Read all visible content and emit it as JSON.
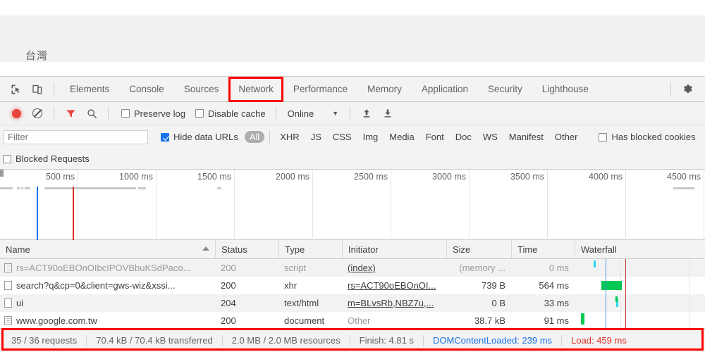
{
  "page": {
    "site_text": "台灣"
  },
  "devtools": {
    "toolbar_icons": {
      "inspect": "inspect-element-icon",
      "device": "device-toolbar-icon",
      "settings": "gear-icon"
    },
    "tabs": [
      {
        "label": "Elements",
        "active": false
      },
      {
        "label": "Console",
        "active": false
      },
      {
        "label": "Sources",
        "active": false
      },
      {
        "label": "Network",
        "active": true
      },
      {
        "label": "Performance",
        "active": false
      },
      {
        "label": "Memory",
        "active": false
      },
      {
        "label": "Application",
        "active": false
      },
      {
        "label": "Security",
        "active": false
      },
      {
        "label": "Lighthouse",
        "active": false
      }
    ]
  },
  "network_toolbar": {
    "record_label": "record-button",
    "clear_label": "clear-button",
    "filter_icon": "filter-funnel-icon",
    "search_icon": "search-icon",
    "preserve_log": {
      "label": "Preserve log",
      "checked": false
    },
    "disable_cache": {
      "label": "Disable cache",
      "checked": false
    },
    "throttling": {
      "value": "Online"
    },
    "import_icon": "upload-har-icon",
    "export_icon": "download-har-icon"
  },
  "filter_bar": {
    "filter_placeholder": "Filter",
    "filter_value": "",
    "hide_data_urls": {
      "label": "Hide data URLs",
      "checked": true
    },
    "types": [
      "All",
      "XHR",
      "JS",
      "CSS",
      "Img",
      "Media",
      "Font",
      "Doc",
      "WS",
      "Manifest",
      "Other"
    ],
    "selected_type": "All",
    "has_blocked_cookies": {
      "label": "Has blocked cookies",
      "checked": false
    },
    "blocked_requests": {
      "label": "Blocked Requests",
      "checked": false
    }
  },
  "overview": {
    "ticks": [
      "500 ms",
      "1000 ms",
      "1500 ms",
      "2000 ms",
      "2500 ms",
      "3000 ms",
      "3500 ms",
      "4000 ms",
      "4500 ms"
    ],
    "dom_content_loaded_color": "#1a73e8",
    "load_color": "#d93025"
  },
  "table": {
    "columns": [
      {
        "label": "Name",
        "sorted": true
      },
      {
        "label": "Status",
        "sorted": false
      },
      {
        "label": "Type",
        "sorted": false
      },
      {
        "label": "Initiator",
        "sorted": false
      },
      {
        "label": "Size",
        "sorted": false
      },
      {
        "label": "Time",
        "sorted": false
      },
      {
        "label": "Waterfall",
        "sorted": false
      }
    ],
    "rows": [
      {
        "name": "rs=ACT90oEBOnOIbcIPOVBbuKSdPaco...",
        "status": "200",
        "type": "script",
        "initiator": "(index)",
        "size": "(memory ...",
        "time": "0 ms",
        "muted": true
      },
      {
        "name": "search?q&cp=0&client=gws-wiz&xssi...",
        "status": "200",
        "type": "xhr",
        "initiator": "rs=ACT90oEBOnOI...",
        "size": "739 B",
        "time": "564 ms",
        "muted": false
      },
      {
        "name": "ui",
        "status": "204",
        "type": "text/html",
        "initiator": "m=BLvsRb,NBZ7u,...",
        "size": "0 B",
        "time": "33 ms",
        "muted": false
      },
      {
        "name": "www.google.com.tw",
        "status": "200",
        "type": "document",
        "initiator": "Other",
        "size": "38.7 kB",
        "time": "91 ms",
        "muted": false
      }
    ]
  },
  "status_bar": {
    "requests": "35 / 36 requests",
    "transferred": "70.4 kB / 70.4 kB transferred",
    "resources": "2.0 MB / 2.0 MB resources",
    "finish": "Finish: 4.81 s",
    "dom_content_loaded": "DOMContentLoaded: 239 ms",
    "load": "Load: 459 ms"
  },
  "highlight_color": "#ff0000"
}
